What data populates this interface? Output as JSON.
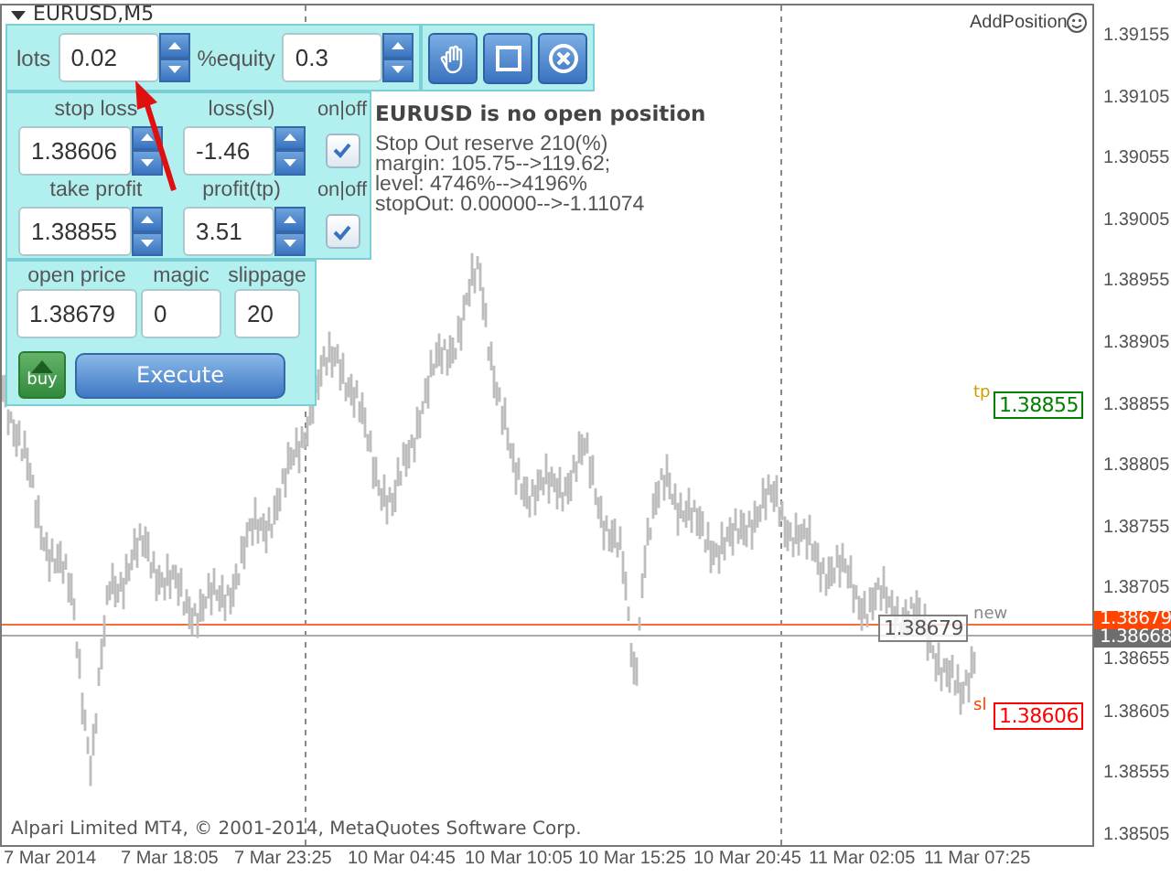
{
  "chart_title": "EURUSD,M5",
  "indicator_name": "AddPosition",
  "order_panel": {
    "lots": {
      "label": "lots",
      "value": "0.02"
    },
    "equity": {
      "label": "%equity",
      "value": "0.3"
    },
    "stop_loss": {
      "label": "stop loss",
      "value": "1.38606"
    },
    "loss_sl": {
      "label": "loss(sl)",
      "value": "-1.46"
    },
    "sl_toggle": {
      "label": "on|off",
      "checked": true
    },
    "take_profit": {
      "label": "take profit",
      "value": "1.38855"
    },
    "profit_tp": {
      "label": "profit(tp)",
      "value": "3.51"
    },
    "tp_toggle": {
      "label": "on|off",
      "checked": true
    },
    "open_price": {
      "label": "open price",
      "value": "1.38679"
    },
    "magic": {
      "label": "magic",
      "value": "0"
    },
    "slippage": {
      "label": "slippage",
      "value": "20"
    },
    "direction": {
      "label": "buy"
    },
    "execute": "Execute"
  },
  "status": {
    "heading": "EURUSD is no open position",
    "lines": [
      "Stop Out reserve 210(%)",
      "margin: 105.75-->119.62;",
      "level: 4746%-->4196%",
      "stopOut: 0.00000-->-1.11074"
    ]
  },
  "price_axis": [
    "1.39155",
    "1.39105",
    "1.39055",
    "1.39005",
    "1.38955",
    "1.38905",
    "1.38855",
    "1.38805",
    "1.38755",
    "1.38705",
    "1.38655",
    "1.38605",
    "1.38555",
    "1.38505"
  ],
  "time_axis": [
    "7 Mar 2014",
    "7 Mar 18:05",
    "7 Mar 23:25",
    "10 Mar 04:45",
    "10 Mar 10:05",
    "10 Mar 15:25",
    "10 Mar 20:45",
    "11 Mar 02:05",
    "11 Mar 07:25"
  ],
  "levels": [
    {
      "kind": "tp",
      "tag": "tp",
      "price": "1.38855",
      "color": "#008000"
    },
    {
      "kind": "open",
      "tag": "new",
      "price": "1.38679",
      "color": "#808080"
    },
    {
      "kind": "sl",
      "tag": "sl",
      "price": "1.38606",
      "color": "#ff0000"
    }
  ],
  "price_tags": [
    {
      "price": "1.38679",
      "color": "#ff4500"
    },
    {
      "price": "1.38668",
      "color": "#6e6e6e"
    }
  ],
  "copyright": "Alpari Limited MT4, © 2001-2014, MetaQuotes Software Corp."
}
